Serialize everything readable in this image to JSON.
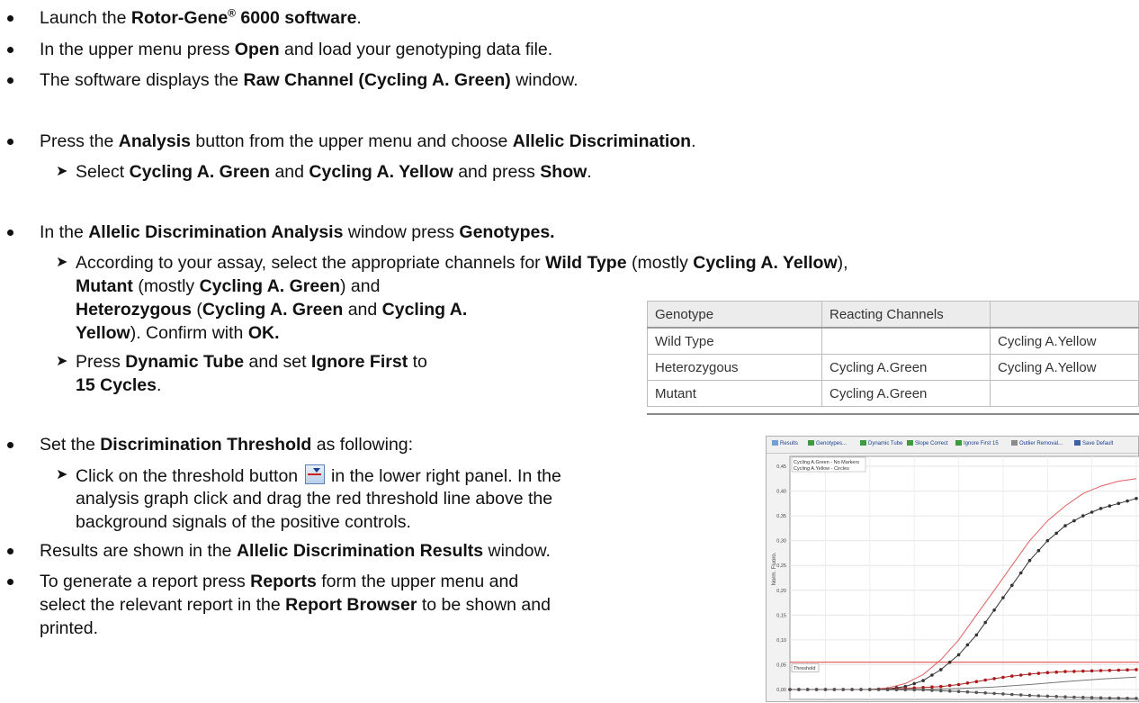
{
  "bullets": [
    {
      "parts": [
        "Launch the ",
        "Rotor-Gene",
        "®",
        " 6000  software",
        "."
      ]
    },
    {
      "parts": [
        "In the upper menu press ",
        "Open",
        " and load your genotyping data file."
      ]
    },
    {
      "parts": [
        "The software displays the ",
        "Raw Channel (Cycling A. Green)",
        " window."
      ]
    },
    {
      "parts": [
        "Press the ",
        "Analysis",
        " button from the upper menu and choose ",
        "Allelic Discrimination",
        "."
      ]
    },
    {
      "parts": [
        "Select ",
        "Cycling A. Green",
        " and ",
        "Cycling A. Yellow",
        " and press ",
        "Show",
        "."
      ]
    },
    {
      "parts": [
        "In the ",
        "Allelic Discrimination Analysis",
        " window press ",
        "Genotypes."
      ]
    },
    {
      "parts": [
        "According to your assay, select the appropriate channels for ",
        "Wild Type",
        " (mostly ",
        "Cycling A. Yellow",
        "),"
      ]
    },
    {
      "parts": [
        "Mutant",
        " (mostly ",
        "Cycling A. Green",
        ") and"
      ]
    },
    {
      "parts": [
        "Heterozygous",
        " (",
        "Cycling A. Green",
        " and ",
        "Cycling A."
      ]
    },
    {
      "parts": [
        "Yellow",
        "). Confirm with ",
        "OK."
      ]
    },
    {
      "parts": [
        "Press ",
        "Dynamic Tube",
        " and set ",
        "Ignore First",
        " to"
      ]
    },
    {
      "parts": [
        "15 Cycles",
        "."
      ]
    },
    {
      "parts": [
        "Set the ",
        "Discrimination Threshold",
        " as following:"
      ]
    },
    {
      "parts": [
        "Click on the threshold button ",
        " in the lower right panel. In the"
      ]
    },
    {
      "parts": [
        "analysis graph click and drag the red threshold line above the"
      ]
    },
    {
      "parts": [
        "background signals of the positive controls."
      ]
    },
    {
      "parts": [
        "Results are shown in the ",
        "Allelic Discrimination Results",
        " window."
      ]
    },
    {
      "parts": [
        "To generate a report press ",
        "Reports",
        " form the upper menu and"
      ]
    },
    {
      "parts": [
        "select the relevant report in the ",
        "Report Browser",
        " to be shown and"
      ]
    },
    {
      "parts": [
        "printed."
      ]
    }
  ],
  "genotype_table": {
    "headers": [
      "Genotype",
      "Reacting Channels",
      ""
    ],
    "rows": [
      [
        "Wild Type",
        "",
        "Cycling A.Yellow"
      ],
      [
        "Heterozygous",
        "Cycling A.Green",
        "Cycling A.Yellow"
      ],
      [
        "Mutant",
        "Cycling A.Green",
        ""
      ]
    ]
  },
  "chart_toolbar": [
    "Results",
    "Genotypes...",
    "Dynamic Tube",
    "Slope Correct",
    "Ignore First 15",
    "Outlier Removal...",
    "Save Default"
  ],
  "chart_data": {
    "type": "line",
    "legend": [
      "Cycling A.Green - No Markers",
      "Cycling A.Yellow - Circles"
    ],
    "ylabel": "Norm. Fluoro.",
    "yticks": [
      "0,45",
      "0,40",
      "0,35",
      "0,30",
      "0,25",
      "0,20",
      "0,15",
      "0,10",
      "0,05",
      "0,00"
    ],
    "ylim": [
      0,
      0.45
    ],
    "xlim": [
      1,
      40
    ],
    "threshold_label": "Threshold",
    "threshold_value": 0.055,
    "series": [
      {
        "color": "#e06060",
        "markers": false,
        "x": [
          1,
          5,
          10,
          12,
          14,
          16,
          18,
          20,
          22,
          24,
          26,
          28,
          30,
          32,
          34,
          36,
          38,
          40
        ],
        "y": [
          0.0,
          0.0,
          0.0,
          0.003,
          0.012,
          0.03,
          0.06,
          0.1,
          0.15,
          0.2,
          0.25,
          0.3,
          0.34,
          0.37,
          0.395,
          0.41,
          0.42,
          0.425
        ]
      },
      {
        "color": "#333333",
        "markers": true,
        "markerColor": "#333333",
        "x": [
          1,
          5,
          10,
          12,
          14,
          16,
          18,
          20,
          22,
          24,
          26,
          28,
          30,
          32,
          34,
          36,
          38,
          40
        ],
        "y": [
          0.0,
          0.0,
          0.0,
          0.001,
          0.006,
          0.018,
          0.04,
          0.07,
          0.11,
          0.16,
          0.21,
          0.26,
          0.3,
          0.33,
          0.35,
          0.365,
          0.375,
          0.385
        ]
      },
      {
        "color": "#a02020",
        "markers": true,
        "markerColor": "#b01818",
        "x": [
          1,
          5,
          10,
          14,
          18,
          20,
          22,
          24,
          26,
          28,
          30,
          32,
          34,
          36,
          38,
          40
        ],
        "y": [
          0.0,
          0.0,
          0.0,
          0.002,
          0.006,
          0.01,
          0.016,
          0.022,
          0.027,
          0.031,
          0.034,
          0.036,
          0.037,
          0.038,
          0.039,
          0.04
        ]
      },
      {
        "color": "#777777",
        "markers": false,
        "x": [
          1,
          10,
          16,
          20,
          24,
          28,
          32,
          36,
          40
        ],
        "y": [
          0.0,
          0.0,
          0.0,
          0.002,
          0.005,
          0.01,
          0.016,
          0.021,
          0.025
        ]
      },
      {
        "color": "#555555",
        "markers": true,
        "markerColor": "#555555",
        "x": [
          1,
          10,
          16,
          20,
          24,
          28,
          32,
          36,
          40
        ],
        "y": [
          0.0,
          0.0,
          -0.001,
          -0.004,
          -0.008,
          -0.012,
          -0.015,
          -0.017,
          -0.018
        ]
      }
    ]
  }
}
